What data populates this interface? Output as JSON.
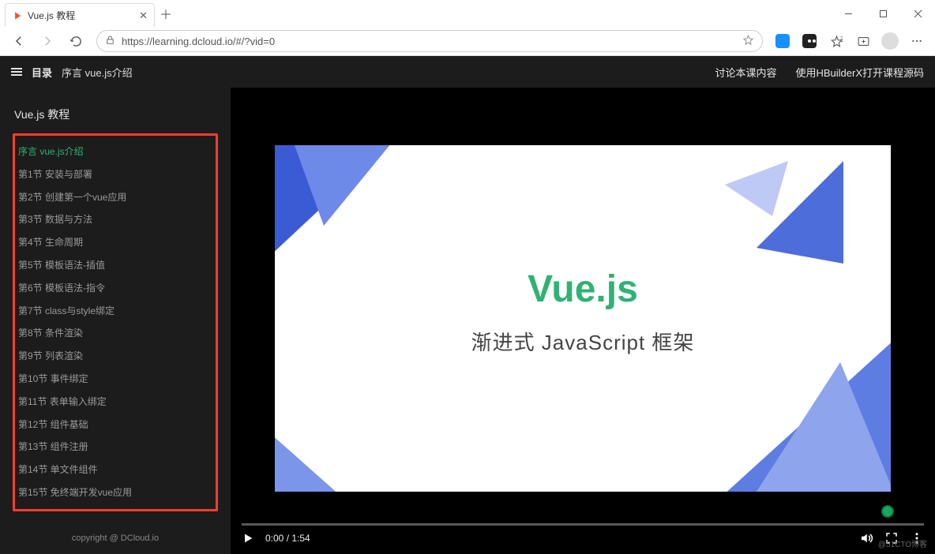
{
  "browser": {
    "tab_title": "Vue.js 教程",
    "url": "https://learning.dcloud.io/#/?vid=0",
    "win_minimize": "–",
    "win_close": "✕"
  },
  "header": {
    "directory_label": "目录",
    "breadcrumb": "序言 vue.js介绍",
    "discuss_link": "讨论本课内容",
    "open_hbuilder_link": "使用HBuilderX打开课程源码"
  },
  "sidebar": {
    "course_title": "Vue.js 教程",
    "items": [
      {
        "label": "序言 vue.js介绍",
        "active": true
      },
      {
        "label": "第1节 安装与部署",
        "active": false
      },
      {
        "label": "第2节 创建第一个vue应用",
        "active": false
      },
      {
        "label": "第3节 数据与方法",
        "active": false
      },
      {
        "label": "第4节 生命周期",
        "active": false
      },
      {
        "label": "第5节 模板语法-插值",
        "active": false
      },
      {
        "label": "第6节 模板语法-指令",
        "active": false
      },
      {
        "label": "第7节 class与style绑定",
        "active": false
      },
      {
        "label": "第8节 条件渲染",
        "active": false
      },
      {
        "label": "第9节 列表渲染",
        "active": false
      },
      {
        "label": "第10节 事件绑定",
        "active": false
      },
      {
        "label": "第11节 表单输入绑定",
        "active": false
      },
      {
        "label": "第12节 组件基础",
        "active": false
      },
      {
        "label": "第13节 组件注册",
        "active": false
      },
      {
        "label": "第14节 单文件组件",
        "active": false
      },
      {
        "label": "第15节 免终端开发vue应用",
        "active": false
      }
    ],
    "copyright": "copyright @ DCloud.io"
  },
  "video": {
    "slide_title": "Vue.js",
    "slide_subtitle": "渐进式 JavaScript 框架",
    "current_time": "0:00",
    "total_time": "1:54",
    "time_sep": " / "
  },
  "watermark": "@51CTO博客"
}
